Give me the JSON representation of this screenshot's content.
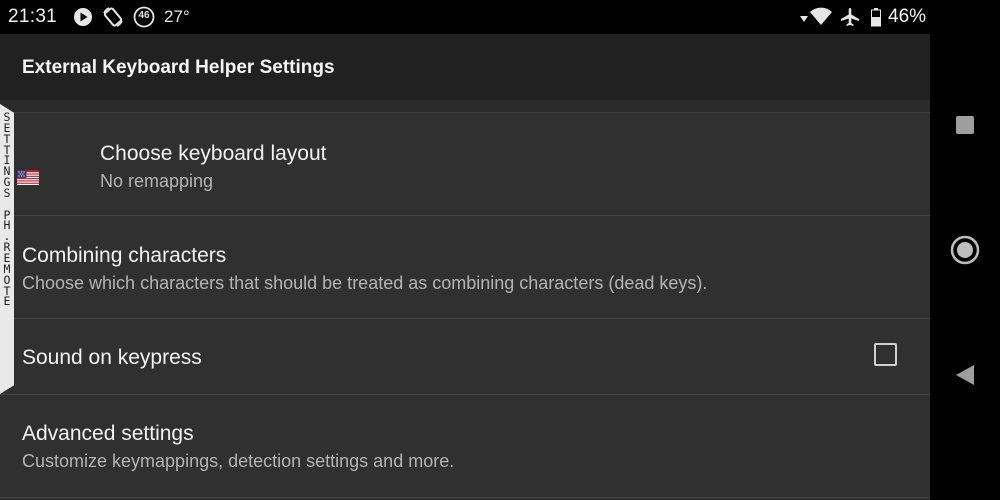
{
  "status_bar": {
    "time": "21:31",
    "notification_badge": "46",
    "temperature": "27°",
    "battery_percent": "46%",
    "icons": [
      "media-play-icon",
      "rotation-lock-icon",
      "badge-46-icon",
      "signal-arrow-icon",
      "wifi-icon",
      "airplane-icon",
      "battery-icon"
    ]
  },
  "app_bar": {
    "title": "External Keyboard Helper Settings"
  },
  "side_tab": {
    "text": "S\nE\nT\nT\nI\nN\nG\nS\n\nP\nH\n.\nR\nE\nM\nO\nT\nE"
  },
  "settings": {
    "layout": {
      "title": "Choose keyboard layout",
      "subtitle": "No remapping",
      "icon": "us-flag-icon"
    },
    "combining": {
      "title": "Combining characters",
      "subtitle": "Choose which characters that should be treated as combining characters (dead keys)."
    },
    "sound": {
      "title": "Sound on keypress",
      "checked": false
    },
    "advanced": {
      "title": "Advanced settings",
      "subtitle": "Customize keymappings, detection settings and more."
    }
  },
  "nav_bar": {
    "buttons": [
      "recents-square-icon",
      "home-circle-icon",
      "back-triangle-icon"
    ]
  },
  "colors": {
    "background": "#303030",
    "app_bar": "#212121",
    "status_bar": "#000000",
    "divider": "#454545",
    "text_primary": "#f2f2f2",
    "text_secondary": "#b4b4b4"
  }
}
